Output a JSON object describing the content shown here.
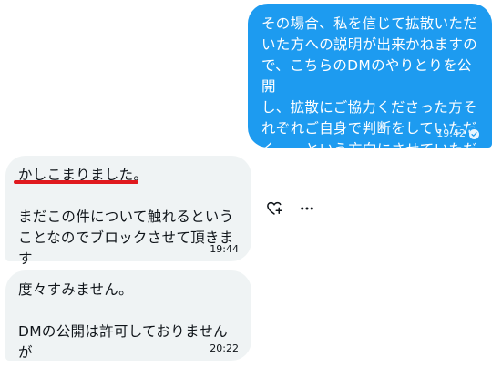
{
  "messages": {
    "outgoing": {
      "text": "その場合、私を信じて拡散いただ\nいた方への説明が出来かねますの\nで、こちらのDMのやりとりを公開\nし、拡散にご協力くださった方そ\nれぞれご自身で判断をしていただ\nく、、、という方向にさせていただ\nきますね。",
      "time": "19:42",
      "status_icon": "seen-check-icon"
    },
    "incoming": [
      {
        "text": "かしこまりました。\n\nまだこの件について触れるという\nことなのでブロックさせて頂きま\nす",
        "time": "19:44"
      },
      {
        "text": "度々すみません。\n\nDMの公開は許可しておりませんが",
        "time": "20:22"
      }
    ]
  },
  "actions": {
    "react_icon": "add-reaction-heart-icon",
    "more_icon": "more-options-icon"
  },
  "colors": {
    "outgoing_bubble": "#1d9bf0",
    "incoming_bubble": "#eff3f4",
    "highlight_underline": "#e0191e",
    "text": "#0f1419"
  }
}
